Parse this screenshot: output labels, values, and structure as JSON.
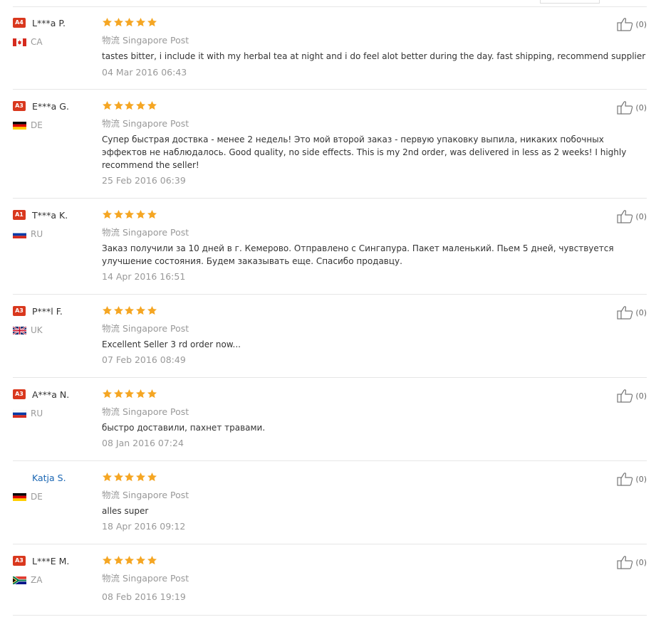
{
  "reviews": [
    {
      "level": "A4",
      "name": "L***a P.",
      "name_link": false,
      "country": "CA",
      "stars": 5,
      "logistics_cn": "物流",
      "logistics": "Singapore Post",
      "feedback": "tastes bitter, i include it with my herbal tea at night and i do feel alot better during the day. fast shipping, recommend supplier",
      "date": "04 Mar 2016 06:43",
      "helpful": "(0)"
    },
    {
      "level": "A3",
      "name": "E***a G.",
      "name_link": false,
      "country": "DE",
      "stars": 5,
      "logistics_cn": "物流",
      "logistics": "Singapore Post",
      "feedback": "Супер быстрая доствка - менее 2 недель! Это мой второй заказ - первую упаковку выпила, никаких побочных эффектов не наблюдалось. Good quality, no side effects. This is my 2nd order, was delivered in less as 2 weeks! I highly recommend the seller!",
      "date": "25 Feb 2016 06:39",
      "helpful": "(0)"
    },
    {
      "level": "A1",
      "name": "T***a K.",
      "name_link": false,
      "country": "RU",
      "stars": 5,
      "logistics_cn": "物流",
      "logistics": "Singapore Post",
      "feedback": "Заказ получили за 10 дней в г. Кемерово. Отправлено с Сингапура. Пакет маленький. Пьем 5 дней, чувствуется улучшение состояния. Будем заказывать еще. Спасибо продавцу.",
      "date": "14 Apr 2016 16:51",
      "helpful": "(0)"
    },
    {
      "level": "A3",
      "name": "P***l F.",
      "name_link": false,
      "country": "UK",
      "stars": 5,
      "logistics_cn": "物流",
      "logistics": "Singapore Post",
      "feedback": "Excellent Seller 3 rd order now...",
      "date": "07 Feb 2016 08:49",
      "helpful": "(0)"
    },
    {
      "level": "A3",
      "name": "A***a N.",
      "name_link": false,
      "country": "RU",
      "stars": 5,
      "logistics_cn": "物流",
      "logistics": "Singapore Post",
      "feedback": "быстро доставили, пахнет травами.",
      "date": "08 Jan 2016 07:24",
      "helpful": "(0)"
    },
    {
      "level": "",
      "name": "Katja S.",
      "name_link": true,
      "country": "DE",
      "stars": 5,
      "logistics_cn": "物流",
      "logistics": "Singapore Post",
      "feedback": "alles super",
      "date": "18 Apr 2016 09:12",
      "helpful": "(0)"
    },
    {
      "level": "A3",
      "name": "L***E M.",
      "name_link": false,
      "country": "ZA",
      "stars": 5,
      "logistics_cn": "物流",
      "logistics": "Singapore Post",
      "feedback": "",
      "date": "08 Feb 2016 19:19",
      "helpful": "(0)"
    }
  ],
  "colors": {
    "star": "#f5a623",
    "level_badge": "#d9381e",
    "link": "#1a66b3",
    "muted": "#999999",
    "text": "#333333",
    "divider": "#e6e6e6"
  },
  "icons": {
    "star": "star-icon",
    "helpful": "thumbs-up-icon",
    "flags": {
      "CA": "flag-ca-icon",
      "DE": "flag-de-icon",
      "RU": "flag-ru-icon",
      "UK": "flag-uk-icon",
      "ZA": "flag-za-icon"
    }
  }
}
